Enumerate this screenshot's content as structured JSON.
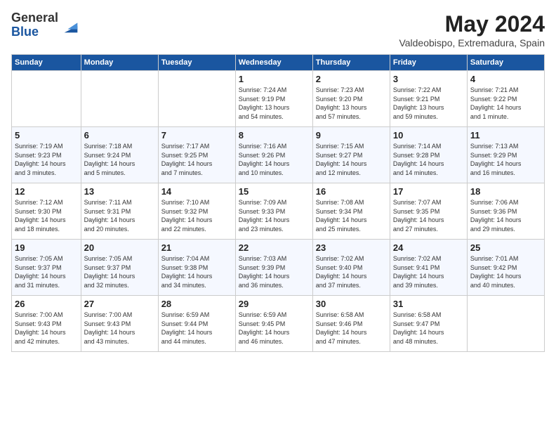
{
  "header": {
    "logo_general": "General",
    "logo_blue": "Blue",
    "month_title": "May 2024",
    "location": "Valdeobispo, Extremadura, Spain"
  },
  "days_of_week": [
    "Sunday",
    "Monday",
    "Tuesday",
    "Wednesday",
    "Thursday",
    "Friday",
    "Saturday"
  ],
  "weeks": [
    [
      {
        "day": "",
        "info": ""
      },
      {
        "day": "",
        "info": ""
      },
      {
        "day": "",
        "info": ""
      },
      {
        "day": "1",
        "info": "Sunrise: 7:24 AM\nSunset: 9:19 PM\nDaylight: 13 hours\nand 54 minutes."
      },
      {
        "day": "2",
        "info": "Sunrise: 7:23 AM\nSunset: 9:20 PM\nDaylight: 13 hours\nand 57 minutes."
      },
      {
        "day": "3",
        "info": "Sunrise: 7:22 AM\nSunset: 9:21 PM\nDaylight: 13 hours\nand 59 minutes."
      },
      {
        "day": "4",
        "info": "Sunrise: 7:21 AM\nSunset: 9:22 PM\nDaylight: 14 hours\nand 1 minute."
      }
    ],
    [
      {
        "day": "5",
        "info": "Sunrise: 7:19 AM\nSunset: 9:23 PM\nDaylight: 14 hours\nand 3 minutes."
      },
      {
        "day": "6",
        "info": "Sunrise: 7:18 AM\nSunset: 9:24 PM\nDaylight: 14 hours\nand 5 minutes."
      },
      {
        "day": "7",
        "info": "Sunrise: 7:17 AM\nSunset: 9:25 PM\nDaylight: 14 hours\nand 7 minutes."
      },
      {
        "day": "8",
        "info": "Sunrise: 7:16 AM\nSunset: 9:26 PM\nDaylight: 14 hours\nand 10 minutes."
      },
      {
        "day": "9",
        "info": "Sunrise: 7:15 AM\nSunset: 9:27 PM\nDaylight: 14 hours\nand 12 minutes."
      },
      {
        "day": "10",
        "info": "Sunrise: 7:14 AM\nSunset: 9:28 PM\nDaylight: 14 hours\nand 14 minutes."
      },
      {
        "day": "11",
        "info": "Sunrise: 7:13 AM\nSunset: 9:29 PM\nDaylight: 14 hours\nand 16 minutes."
      }
    ],
    [
      {
        "day": "12",
        "info": "Sunrise: 7:12 AM\nSunset: 9:30 PM\nDaylight: 14 hours\nand 18 minutes."
      },
      {
        "day": "13",
        "info": "Sunrise: 7:11 AM\nSunset: 9:31 PM\nDaylight: 14 hours\nand 20 minutes."
      },
      {
        "day": "14",
        "info": "Sunrise: 7:10 AM\nSunset: 9:32 PM\nDaylight: 14 hours\nand 22 minutes."
      },
      {
        "day": "15",
        "info": "Sunrise: 7:09 AM\nSunset: 9:33 PM\nDaylight: 14 hours\nand 23 minutes."
      },
      {
        "day": "16",
        "info": "Sunrise: 7:08 AM\nSunset: 9:34 PM\nDaylight: 14 hours\nand 25 minutes."
      },
      {
        "day": "17",
        "info": "Sunrise: 7:07 AM\nSunset: 9:35 PM\nDaylight: 14 hours\nand 27 minutes."
      },
      {
        "day": "18",
        "info": "Sunrise: 7:06 AM\nSunset: 9:36 PM\nDaylight: 14 hours\nand 29 minutes."
      }
    ],
    [
      {
        "day": "19",
        "info": "Sunrise: 7:05 AM\nSunset: 9:37 PM\nDaylight: 14 hours\nand 31 minutes."
      },
      {
        "day": "20",
        "info": "Sunrise: 7:05 AM\nSunset: 9:37 PM\nDaylight: 14 hours\nand 32 minutes."
      },
      {
        "day": "21",
        "info": "Sunrise: 7:04 AM\nSunset: 9:38 PM\nDaylight: 14 hours\nand 34 minutes."
      },
      {
        "day": "22",
        "info": "Sunrise: 7:03 AM\nSunset: 9:39 PM\nDaylight: 14 hours\nand 36 minutes."
      },
      {
        "day": "23",
        "info": "Sunrise: 7:02 AM\nSunset: 9:40 PM\nDaylight: 14 hours\nand 37 minutes."
      },
      {
        "day": "24",
        "info": "Sunrise: 7:02 AM\nSunset: 9:41 PM\nDaylight: 14 hours\nand 39 minutes."
      },
      {
        "day": "25",
        "info": "Sunrise: 7:01 AM\nSunset: 9:42 PM\nDaylight: 14 hours\nand 40 minutes."
      }
    ],
    [
      {
        "day": "26",
        "info": "Sunrise: 7:00 AM\nSunset: 9:43 PM\nDaylight: 14 hours\nand 42 minutes."
      },
      {
        "day": "27",
        "info": "Sunrise: 7:00 AM\nSunset: 9:43 PM\nDaylight: 14 hours\nand 43 minutes."
      },
      {
        "day": "28",
        "info": "Sunrise: 6:59 AM\nSunset: 9:44 PM\nDaylight: 14 hours\nand 44 minutes."
      },
      {
        "day": "29",
        "info": "Sunrise: 6:59 AM\nSunset: 9:45 PM\nDaylight: 14 hours\nand 46 minutes."
      },
      {
        "day": "30",
        "info": "Sunrise: 6:58 AM\nSunset: 9:46 PM\nDaylight: 14 hours\nand 47 minutes."
      },
      {
        "day": "31",
        "info": "Sunrise: 6:58 AM\nSunset: 9:47 PM\nDaylight: 14 hours\nand 48 minutes."
      },
      {
        "day": "",
        "info": ""
      }
    ]
  ]
}
